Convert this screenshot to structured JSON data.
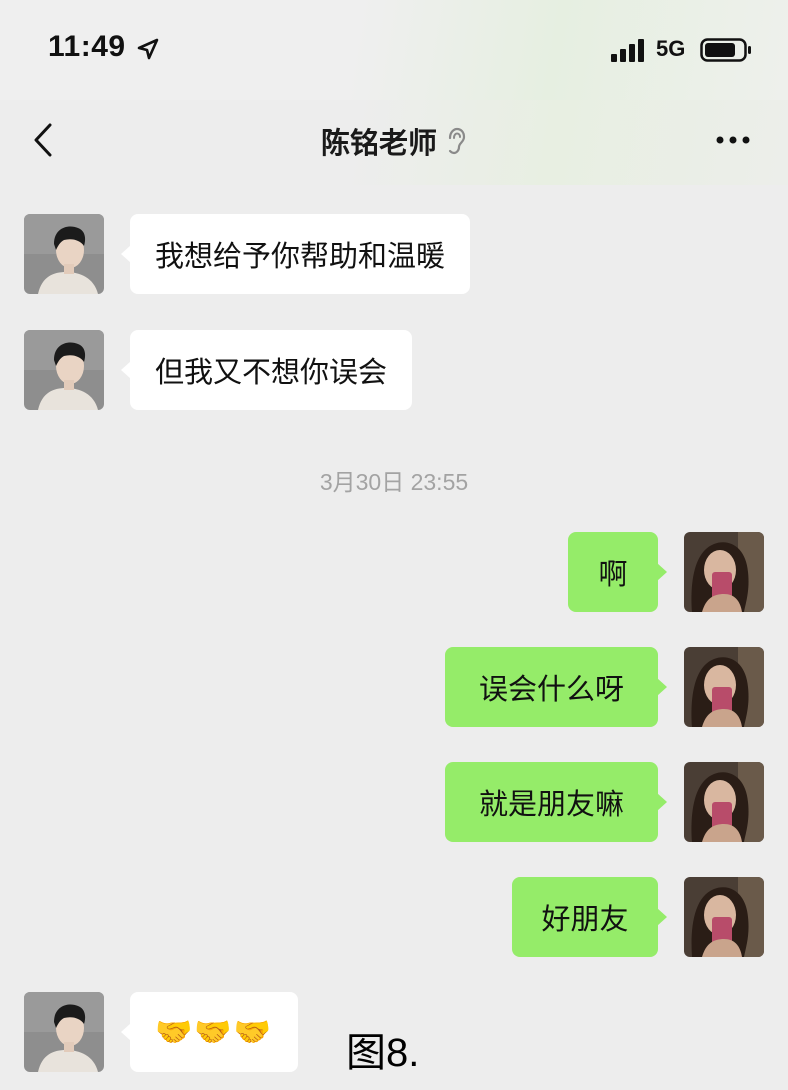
{
  "status": {
    "time": "11:49",
    "network": "5G"
  },
  "header": {
    "title": "陈铭老师"
  },
  "messages": [
    {
      "side": "left",
      "text": "我想给予你帮助和温暖"
    },
    {
      "side": "left",
      "text": "但我又不想你误会"
    },
    {
      "timestamp": "3月30日 23:55"
    },
    {
      "side": "right",
      "text": "啊"
    },
    {
      "side": "right",
      "text": "误会什么呀"
    },
    {
      "side": "right",
      "text": "就是朋友嘛"
    },
    {
      "side": "right",
      "text": "好朋友"
    },
    {
      "side": "left",
      "text": "🤝🤝🤝"
    }
  ],
  "caption": "图8.",
  "icons": {
    "back": "chevron-left-icon",
    "ear": "ear-icon",
    "more": "more-icon",
    "signal": "signal-icon",
    "battery": "battery-icon",
    "location": "location-arrow-icon"
  },
  "colors": {
    "background": "#ededed",
    "bubble_self": "#95ec69",
    "bubble_other": "#ffffff"
  }
}
